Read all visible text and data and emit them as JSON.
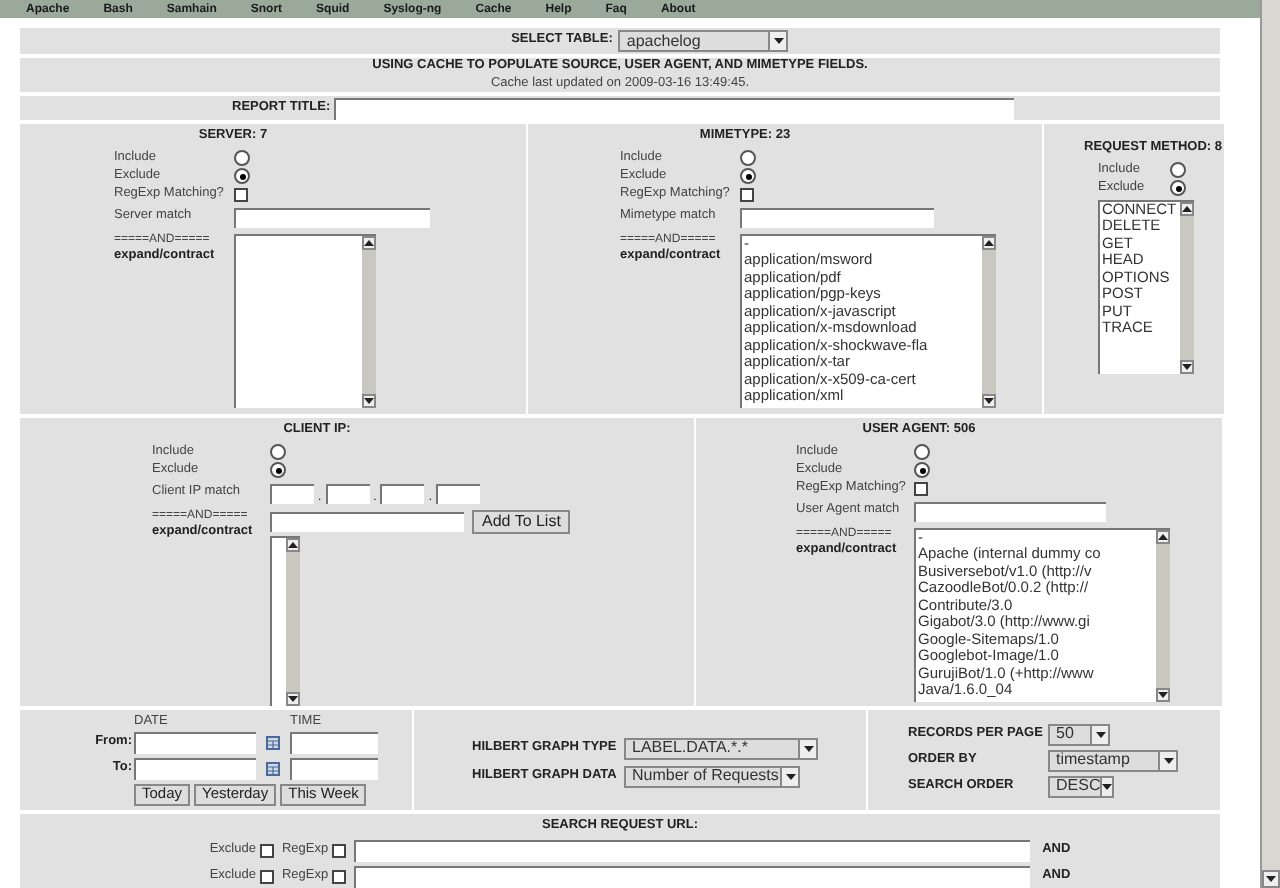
{
  "menu": [
    "Apache",
    "Bash",
    "Samhain",
    "Snort",
    "Squid",
    "Syslog-ng",
    "Cache",
    "Help",
    "Faq",
    "About"
  ],
  "select_table": {
    "label": "SELECT TABLE:",
    "value": "apachelog"
  },
  "cache_notice": {
    "title": "USING CACHE TO POPULATE SOURCE, USER AGENT, AND MIMETYPE FIELDS.",
    "subtitle": "Cache last updated on 2009-03-16 13:49:45."
  },
  "report_title": {
    "label": "REPORT TITLE:"
  },
  "filter_rows": [
    [
      {
        "title": "SERVER: 7",
        "options": [
          {
            "kind": "radio",
            "label": "Include",
            "selected": false
          },
          {
            "kind": "radio",
            "label": "Exclude",
            "selected": true
          },
          {
            "kind": "checkbox",
            "label": "RegExp Matching?",
            "checked": false
          },
          {
            "kind": "text",
            "label": "Server match"
          }
        ],
        "and_label": "=====AND=====",
        "expand_link": "expand/contract"
      },
      {
        "title": "MIMETYPE: 23",
        "options": [
          {
            "kind": "radio",
            "label": "Include",
            "selected": false
          },
          {
            "kind": "radio",
            "label": "Exclude",
            "selected": true
          },
          {
            "kind": "checkbox",
            "label": "RegExp Matching?",
            "checked": false
          },
          {
            "kind": "text",
            "label": "Mimetype match"
          }
        ],
        "and_label": "=====AND=====",
        "expand_link": "expand/contract",
        "list": [
          "-",
          "application/msword",
          "application/pdf",
          "application/pgp-keys",
          "application/x-javascript",
          "application/x-msdownload",
          "application/x-shockwave-fla",
          "application/x-tar",
          "application/x-x509-ca-cert",
          "application/xml"
        ]
      },
      {
        "title": "REQUEST METHOD: 8",
        "options": [
          {
            "kind": "radio",
            "label": "Include",
            "selected": false
          },
          {
            "kind": "radio",
            "label": "Exclude",
            "selected": true
          }
        ],
        "list": [
          "CONNECT",
          "DELETE",
          "GET",
          "HEAD",
          "OPTIONS",
          "POST",
          "PUT",
          "TRACE"
        ]
      }
    ],
    [
      {
        "title": "CLIENT IP:",
        "options": [
          {
            "kind": "radio",
            "label": "Include",
            "selected": false
          },
          {
            "kind": "radio",
            "label": "Exclude",
            "selected": true
          },
          {
            "kind": "ip",
            "label": "Client IP match",
            "separator": "."
          }
        ],
        "and_label": "=====AND=====",
        "expand_link": "expand/contract",
        "add_button": "Add To List"
      },
      {
        "title": "USER AGENT: 506",
        "options": [
          {
            "kind": "radio",
            "label": "Include",
            "selected": false
          },
          {
            "kind": "radio",
            "label": "Exclude",
            "selected": true
          },
          {
            "kind": "checkbox",
            "label": "RegExp Matching?",
            "checked": false
          },
          {
            "kind": "text",
            "label": "User Agent match"
          }
        ],
        "and_label": "=====AND=====",
        "expand_link": "expand/contract",
        "list": [
          "-",
          "Apache (internal dummy co",
          "Busiversebot/v1.0 (http://v",
          "CazoodleBot/0.0.2 (http://",
          "Contribute/3.0",
          "Gigabot/3.0 (http://www.gi",
          "Google-Sitemaps/1.0",
          "Googlebot-Image/1.0",
          "GurujiBot/1.0 (+http://www",
          "Java/1.6.0_04"
        ]
      }
    ]
  ],
  "date_panel": {
    "date_heading": "DATE",
    "time_heading": "TIME",
    "from_label": "From:",
    "to_label": "To:",
    "buttons": [
      "Today",
      "Yesterday",
      "This Week"
    ]
  },
  "hilbert": {
    "type_label": "HILBERT GRAPH TYPE",
    "type_value": "LABEL.DATA.*.*",
    "data_label": "HILBERT GRAPH DATA",
    "data_value": "Number of Requests"
  },
  "records": {
    "per_page_label": "RECORDS PER PAGE",
    "per_page_value": "50",
    "order_by_label": "ORDER BY",
    "order_by_value": "timestamp",
    "order_label": "SEARCH ORDER",
    "order_value": "DESC"
  },
  "search_url": {
    "title": "SEARCH REQUEST URL:",
    "rows": [
      {
        "exclude_label": "Exclude",
        "exclude_checked": false,
        "regexp_label": "RegExp",
        "regexp_checked": false,
        "joiner": "AND"
      },
      {
        "exclude_label": "Exclude",
        "exclude_checked": false,
        "regexp_label": "RegExp",
        "regexp_checked": false,
        "joiner": "AND"
      }
    ]
  }
}
